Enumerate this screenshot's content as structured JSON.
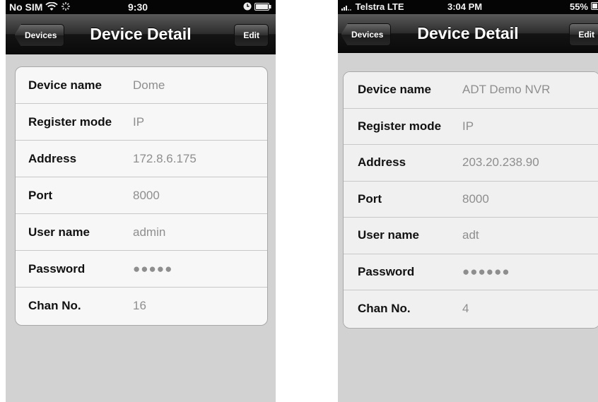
{
  "left": {
    "status": {
      "carrier": "No SIM",
      "time": "9:30",
      "icons": [
        "wifi-icon",
        "activity-spinner-icon",
        "clock-icon",
        "battery-icon"
      ]
    },
    "nav": {
      "back_label": "Devices",
      "title": "Device Detail",
      "edit_label": "Edit"
    },
    "rows": [
      {
        "label": "Device name",
        "value": "Dome"
      },
      {
        "label": "Register mode",
        "value": "IP"
      },
      {
        "label": "Address",
        "value": "172.8.6.175"
      },
      {
        "label": "Port",
        "value": "8000"
      },
      {
        "label": "User name",
        "value": "admin"
      },
      {
        "label": "Password",
        "value": "●●●●●"
      },
      {
        "label": "Chan No.",
        "value": "16"
      }
    ]
  },
  "right": {
    "status": {
      "carrier": "Telstra  LTE",
      "time": "3:04 PM",
      "battery": "55%",
      "icons": [
        "signal-icon",
        "battery-icon"
      ]
    },
    "nav": {
      "back_label": "Devices",
      "title": "Device Detail",
      "edit_label": "Edit"
    },
    "rows": [
      {
        "label": "Device name",
        "value": "ADT Demo NVR"
      },
      {
        "label": "Register mode",
        "value": "IP"
      },
      {
        "label": "Address",
        "value": "203.20.238.90"
      },
      {
        "label": "Port",
        "value": "8000"
      },
      {
        "label": "User name",
        "value": "adt"
      },
      {
        "label": "Password",
        "value": "●●●●●●"
      },
      {
        "label": "Chan No.",
        "value": "4"
      }
    ]
  }
}
